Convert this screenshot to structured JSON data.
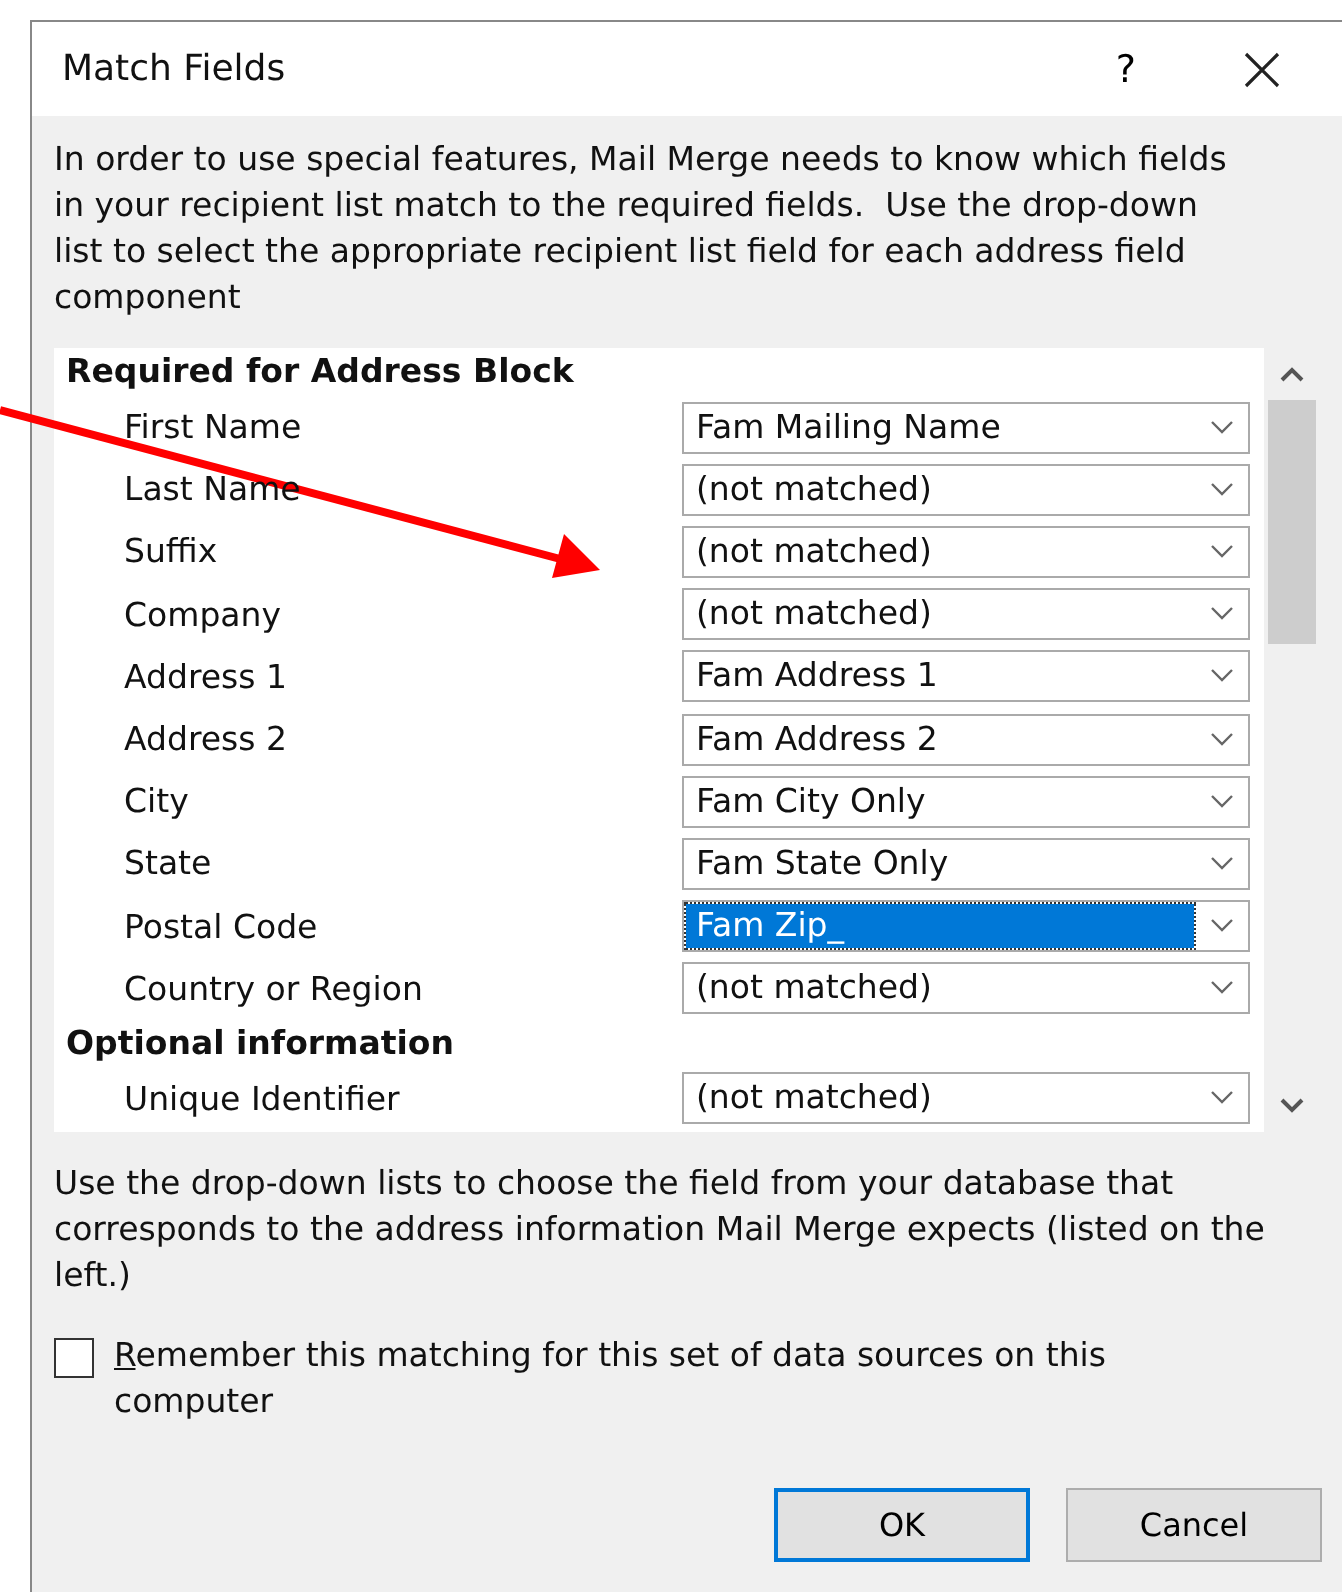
{
  "window": {
    "title": "Match Fields",
    "help": "?"
  },
  "intro": "In order to use special features, Mail Merge needs to know which fields in your recipient list match to the required fields.  Use the drop-down list to select the appropriate recipient list field for each address field component",
  "sections": [
    {
      "heading": "Required for Address Block",
      "fields": [
        {
          "label": "First Name",
          "value": "Fam Mailing Name",
          "selected": false
        },
        {
          "label": "Last Name",
          "value": "(not matched)",
          "selected": false
        },
        {
          "label": "Suffix",
          "value": "(not matched)",
          "selected": false
        },
        {
          "label": "Company",
          "value": "(not matched)",
          "selected": false
        },
        {
          "label": "Address 1",
          "value": "Fam Address 1",
          "selected": false
        },
        {
          "label": "Address 2",
          "value": "Fam Address 2",
          "selected": false
        },
        {
          "label": "City",
          "value": "Fam City Only",
          "selected": false
        },
        {
          "label": "State",
          "value": "Fam State Only",
          "selected": false
        },
        {
          "label": "Postal Code",
          "value": "Fam Zip_",
          "selected": true
        },
        {
          "label": "Country or Region",
          "value": "(not matched)",
          "selected": false
        }
      ]
    },
    {
      "heading": "Optional information",
      "fields": [
        {
          "label": "Unique Identifier",
          "value": "(not matched)",
          "selected": false
        }
      ]
    }
  ],
  "hint": "Use the drop-down lists to choose the field from your database that corresponds to the address information Mail Merge expects (listed on the left.)",
  "remember": {
    "label": "Remember this matching for this set of data sources on this computer",
    "checked": false
  },
  "buttons": [
    {
      "label": "OK",
      "default": true
    },
    {
      "label": "Cancel",
      "default": false
    }
  ]
}
